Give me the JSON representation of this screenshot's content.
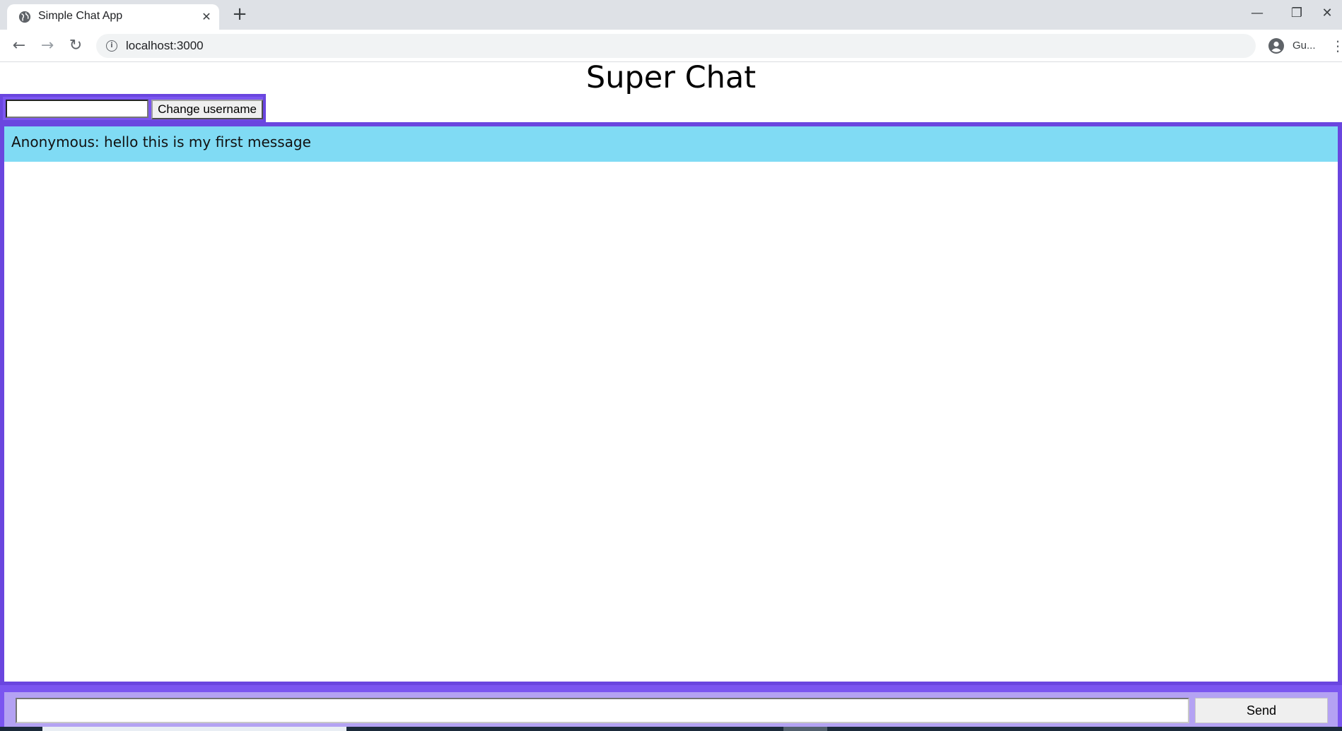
{
  "browser": {
    "tab_title": "Simple Chat App",
    "tab_icon": "globe-icon",
    "close_glyph": "✕",
    "new_tab_glyph": "+",
    "url": "localhost:3000",
    "profile_label": "Gu...",
    "window_controls": {
      "minimize": "—",
      "restore": "❐",
      "close": "✕"
    },
    "nav": {
      "back": "←",
      "forward": "→",
      "reload": "↻",
      "menu": "⋮"
    }
  },
  "page": {
    "title": "Super Chat",
    "username": {
      "value": "",
      "button_label": "Change username"
    },
    "messages": [
      {
        "text": "Anonymous: hello this is my first message"
      }
    ],
    "composer": {
      "value": "",
      "send_label": "Send"
    },
    "colors": {
      "accent_purple": "#7b56f0",
      "accent_purple_dark": "#6a46df",
      "message_bg": "#80dbf4",
      "composer_bg": "#b4a2f3"
    }
  }
}
